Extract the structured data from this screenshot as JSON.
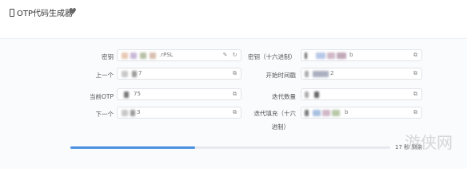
{
  "header": {
    "title": "OTP代码生成器"
  },
  "fields": {
    "secret": {
      "label": "密钥",
      "value": ".rPSL"
    },
    "secret_hex": {
      "label": "密钥（十六进制）",
      "value": "b"
    },
    "previous": {
      "label": "上一个",
      "value": "7"
    },
    "start_time": {
      "label": "开始时间戳",
      "value": "2"
    },
    "current": {
      "label": "当前OTP",
      "value": "75"
    },
    "iterations": {
      "label": "迭代数量",
      "value": ""
    },
    "next": {
      "label": "下一个",
      "value": "3"
    },
    "iter_fill": {
      "label_line1": "迭代填充（十六",
      "label_line2": "进制）",
      "value": "b"
    }
  },
  "progress": {
    "fraction": 0.39,
    "text": "17 秒 剩余"
  },
  "icons": {
    "copy": "copy-icon",
    "refresh": "refresh-icon",
    "edit": "edit-icon",
    "heart": "heart-icon"
  }
}
